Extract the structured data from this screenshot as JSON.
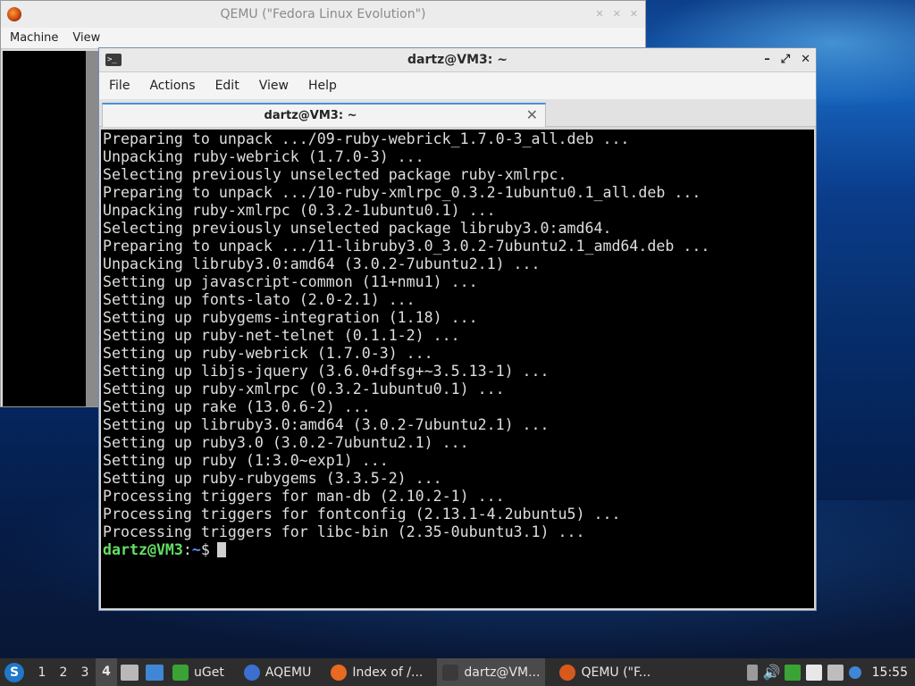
{
  "qemu_window": {
    "title": "QEMU (\"Fedora Linux Evolution\")",
    "menu": [
      "Machine",
      "View"
    ]
  },
  "terminal_window": {
    "title": "dartz@VM3: ~",
    "menu": [
      "File",
      "Actions",
      "Edit",
      "View",
      "Help"
    ],
    "tab_label": "dartz@VM3: ~",
    "lines": [
      "Preparing to unpack .../09-ruby-webrick_1.7.0-3_all.deb ...",
      "Unpacking ruby-webrick (1.7.0-3) ...",
      "Selecting previously unselected package ruby-xmlrpc.",
      "Preparing to unpack .../10-ruby-xmlrpc_0.3.2-1ubuntu0.1_all.deb ...",
      "Unpacking ruby-xmlrpc (0.3.2-1ubuntu0.1) ...",
      "Selecting previously unselected package libruby3.0:amd64.",
      "Preparing to unpack .../11-libruby3.0_3.0.2-7ubuntu2.1_amd64.deb ...",
      "Unpacking libruby3.0:amd64 (3.0.2-7ubuntu2.1) ...",
      "Setting up javascript-common (11+nmu1) ...",
      "Setting up fonts-lato (2.0-2.1) ...",
      "Setting up rubygems-integration (1.18) ...",
      "Setting up ruby-net-telnet (0.1.1-2) ...",
      "Setting up ruby-webrick (1.7.0-3) ...",
      "Setting up libjs-jquery (3.6.0+dfsg+~3.5.13-1) ...",
      "Setting up ruby-xmlrpc (0.3.2-1ubuntu0.1) ...",
      "Setting up rake (13.0.6-2) ...",
      "Setting up libruby3.0:amd64 (3.0.2-7ubuntu2.1) ...",
      "Setting up ruby3.0 (3.0.2-7ubuntu2.1) ...",
      "Setting up ruby (1:3.0~exp1) ...",
      "Setting up ruby-rubygems (3.3.5-2) ...",
      "Processing triggers for man-db (2.10.2-1) ...",
      "Processing triggers for fontconfig (2.13.1-4.2ubuntu5) ...",
      "Processing triggers for libc-bin (2.35-0ubuntu3.1) ..."
    ],
    "prompt": {
      "user": "dartz@VM3",
      "sep": ":",
      "path": "~",
      "symbol": "$"
    }
  },
  "taskbar": {
    "workspaces": [
      "1",
      "2",
      "3",
      "4"
    ],
    "active_workspace": "4",
    "items": [
      {
        "label": "uGet",
        "icon": "uget-icon",
        "color": "#3aa335"
      },
      {
        "label": "AQEMU",
        "icon": "aqemu-icon",
        "color": "#3b6fd1"
      },
      {
        "label": "Index of /...",
        "icon": "firefox-icon",
        "color": "#e66a1f"
      },
      {
        "label": "dartz@VM...",
        "icon": "terminal-icon",
        "color": "#3a3a3a"
      },
      {
        "label": "QEMU (\"F...",
        "icon": "qemu-icon",
        "color": "#d8591c"
      }
    ],
    "clock": "15:55"
  },
  "colors": {
    "prompt_user": "#62e062",
    "prompt_path": "#5c8fff",
    "terminal_bg": "#000000",
    "terminal_fg": "#dedede"
  }
}
